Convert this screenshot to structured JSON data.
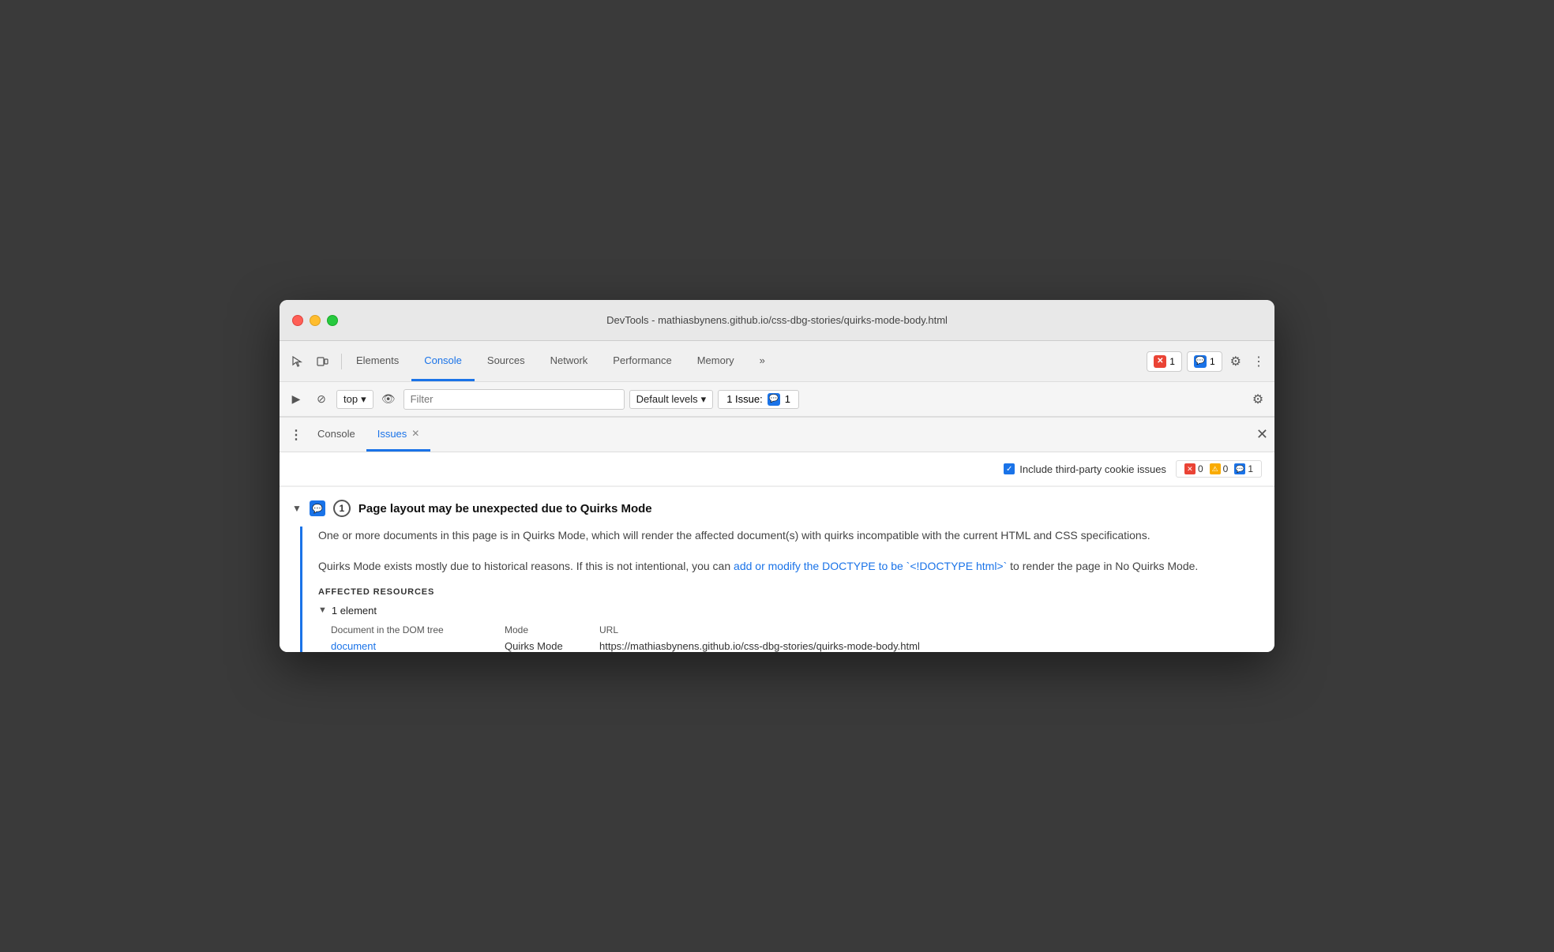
{
  "window": {
    "title": "DevTools - mathiasbynens.github.io/css-dbg-stories/quirks-mode-body.html"
  },
  "tabs": {
    "items": [
      {
        "label": "Elements",
        "active": false
      },
      {
        "label": "Console",
        "active": true
      },
      {
        "label": "Sources",
        "active": false
      },
      {
        "label": "Network",
        "active": false
      },
      {
        "label": "Performance",
        "active": false
      },
      {
        "label": "Memory",
        "active": false
      }
    ],
    "more_label": "»",
    "error_count": "1",
    "message_count": "1"
  },
  "console_toolbar": {
    "top_label": "top",
    "filter_placeholder": "Filter",
    "levels_label": "Default levels",
    "issues_label": "1 Issue:",
    "issues_count": "1"
  },
  "panel": {
    "tabs": [
      {
        "label": "Console",
        "active": false,
        "closable": false
      },
      {
        "label": "Issues",
        "active": true,
        "closable": true
      }
    ],
    "more_label": "⋮"
  },
  "issues_filter": {
    "checkbox_label": "Include third-party cookie issues",
    "error_count": "0",
    "warning_count": "0",
    "info_count": "1"
  },
  "issue": {
    "title": "Page layout may be unexpected due to Quirks Mode",
    "count": "1",
    "description_1": "One or more documents in this page is in Quirks Mode, which will render the affected document(s) with quirks incompatible with the current HTML and CSS specifications.",
    "description_2_pre": "Quirks Mode exists mostly due to historical reasons. If this is not intentional, you can ",
    "description_2_link": "add or modify the DOCTYPE to be `<!DOCTYPE html>`",
    "description_2_post": " to render the page in No Quirks Mode.",
    "affected_label": "AFFECTED RESOURCES",
    "element_count": "1 element",
    "col_doc": "Document in the DOM tree",
    "col_mode": "Mode",
    "col_url": "URL",
    "resource_link": "document",
    "resource_mode": "Quirks Mode",
    "resource_url": "https://mathiasbynens.github.io/css-dbg-stories/quirks-mode-body.html"
  }
}
